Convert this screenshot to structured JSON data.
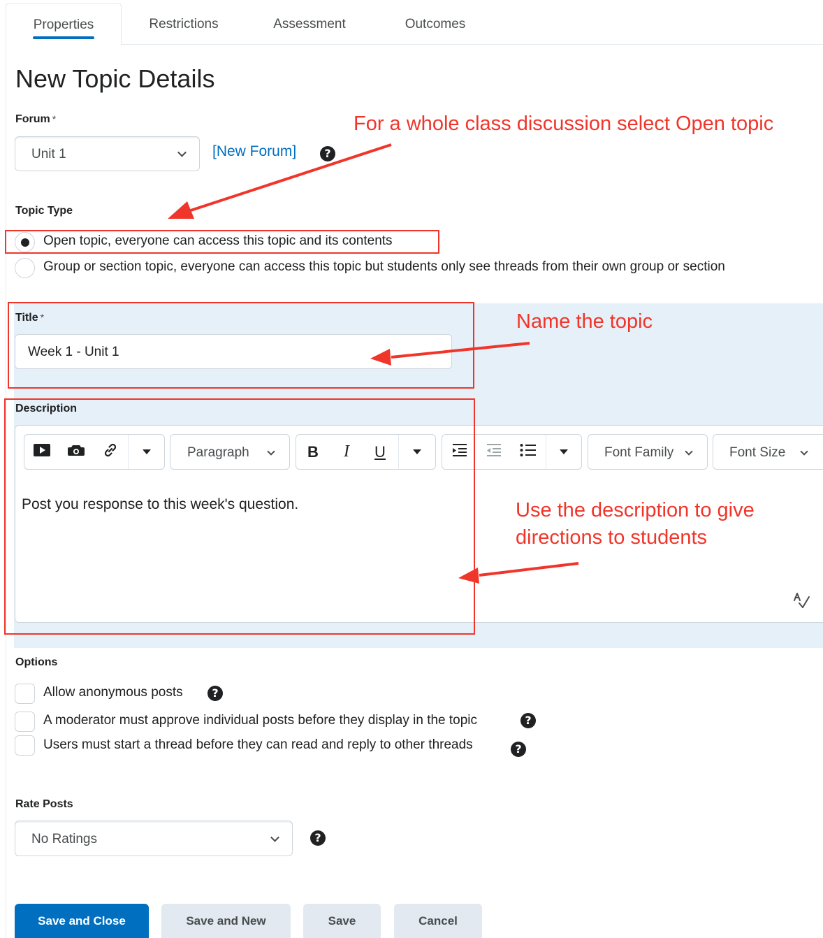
{
  "tabs": [
    {
      "label": "Properties"
    },
    {
      "label": "Restrictions"
    },
    {
      "label": "Assessment"
    },
    {
      "label": "Outcomes"
    }
  ],
  "page_title": "New Topic Details",
  "forum": {
    "label": "Forum",
    "required_mark": "*",
    "selected": "Unit 1",
    "new_forum_link": "[New Forum]"
  },
  "topic_type": {
    "label": "Topic Type",
    "options": [
      {
        "label": "Open topic, everyone can access this topic and its contents",
        "checked": true
      },
      {
        "label": "Group or section topic, everyone can access this topic but students only see threads from their own group or section",
        "checked": false
      }
    ]
  },
  "title_field": {
    "label": "Title",
    "required_mark": "*",
    "value": "Week 1 - Unit 1"
  },
  "description": {
    "label": "Description",
    "toolbar": {
      "block_format": "Paragraph",
      "bold": "B",
      "italic": "I",
      "underline": "U",
      "font_family": "Font Family",
      "font_size": "Font Size"
    },
    "content": "Post you response to this week's question."
  },
  "options": {
    "label": "Options",
    "items": [
      {
        "label": "Allow anonymous posts",
        "checked": false
      },
      {
        "label": "A moderator must approve individual posts before they display in the topic",
        "checked": false
      },
      {
        "label": "Users must start a thread before they can read and reply to other threads",
        "checked": false
      }
    ]
  },
  "rate_posts": {
    "label": "Rate Posts",
    "selected": "No Ratings"
  },
  "buttons": {
    "save_close": "Save and Close",
    "save_new": "Save and New",
    "save": "Save",
    "cancel": "Cancel"
  },
  "help_glyph": "?",
  "annotations": {
    "open_topic": "For a whole class discussion select Open topic",
    "name_topic": "Name the topic",
    "description_line1": "Use the description to give",
    "description_line2": "directions to students"
  },
  "colors": {
    "primary": "#006fbf",
    "annotation": "#f0352a",
    "highlight": "#e6f0f8"
  }
}
